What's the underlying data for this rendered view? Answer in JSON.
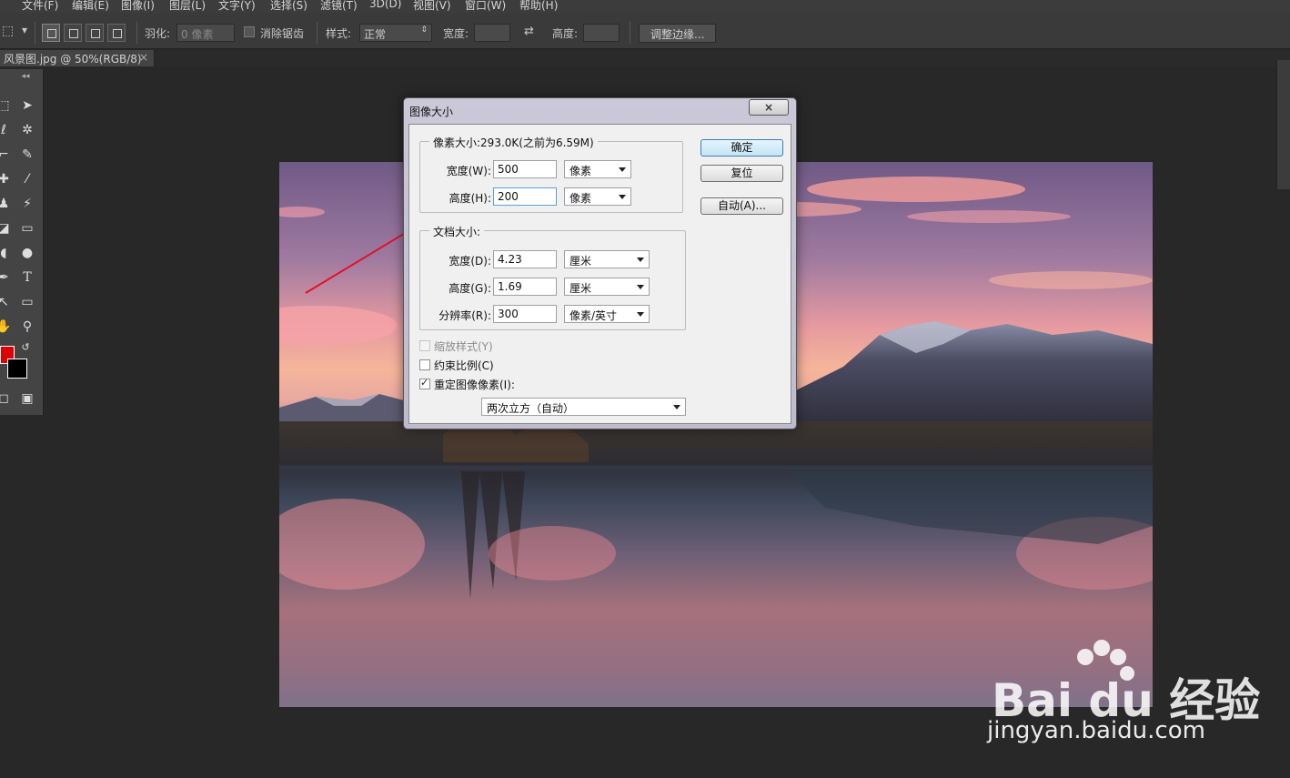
{
  "menu": [
    "文件(F)",
    "编辑(E)",
    "图像(I)",
    "图层(L)",
    "文字(Y)",
    "选择(S)",
    "滤镜(T)",
    "3D(D)",
    "视图(V)",
    "窗口(W)",
    "帮助(H)"
  ],
  "options": {
    "feather_label": "羽化:",
    "feather_value": "0 像素",
    "antialias_label": "消除锯齿",
    "style_label": "样式:",
    "style_value": "正常",
    "width_label": "宽度:",
    "height_label": "高度:",
    "refine_edge": "调整边缘..."
  },
  "document_tab": {
    "title": "风景图.jpg @ 50%(RGB/8)",
    "close": "×"
  },
  "colors": {
    "foreground": "#d40000",
    "background": "#000000",
    "arrow": "#e0102a"
  },
  "dialog": {
    "title": "图像大小",
    "close": "×",
    "pixel_dimensions": {
      "legend": "像素大小:293.0K(之前为6.59M)",
      "width_label": "宽度(W):",
      "width_value": "500",
      "width_unit": "像素",
      "height_label": "高度(H):",
      "height_value": "200",
      "height_unit": "像素"
    },
    "document_size": {
      "legend": "文档大小:",
      "width_label": "宽度(D):",
      "width_value": "4.23",
      "width_unit": "厘米",
      "height_label": "高度(G):",
      "height_value": "1.69",
      "height_unit": "厘米",
      "resolution_label": "分辨率(R):",
      "resolution_value": "300",
      "resolution_unit": "像素/英寸"
    },
    "scale_styles": {
      "label": "缩放样式(Y)",
      "checked": false,
      "disabled": true
    },
    "constrain": {
      "label": "约束比例(C)",
      "checked": false
    },
    "resample": {
      "label": "重定图像像素(I):",
      "checked": true
    },
    "resample_method": "两次立方（自动）",
    "buttons": {
      "ok": "确定",
      "reset": "复位",
      "auto": "自动(A)..."
    }
  },
  "watermark": {
    "brand": "Bai du 经验",
    "url": "jingyan.baidu.com"
  }
}
